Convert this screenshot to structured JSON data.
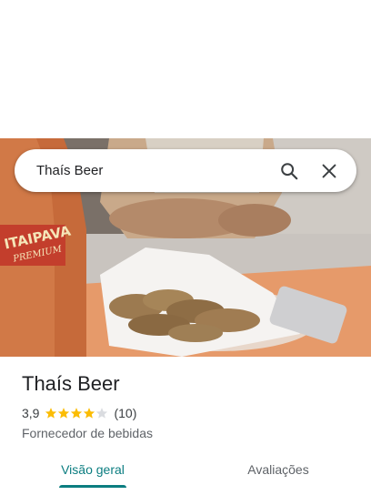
{
  "search": {
    "query": "Thaís Beer",
    "search_icon": "search-icon",
    "close_icon": "close-icon"
  },
  "hero": {
    "bottle_label": "ITAIPAVA",
    "bottle_sublabel": "PREMIUM"
  },
  "place": {
    "name": "Thaís Beer",
    "rating": "3,9",
    "rating_value": 3.9,
    "review_count": "(10)",
    "category": "Fornecedor de bebidas"
  },
  "tabs": [
    {
      "label": "Visão geral",
      "active": true
    },
    {
      "label": "Avaliações",
      "active": false
    }
  ],
  "colors": {
    "accent": "#0b7d80",
    "star": "#fbbc04",
    "star_empty": "#dadce0"
  }
}
